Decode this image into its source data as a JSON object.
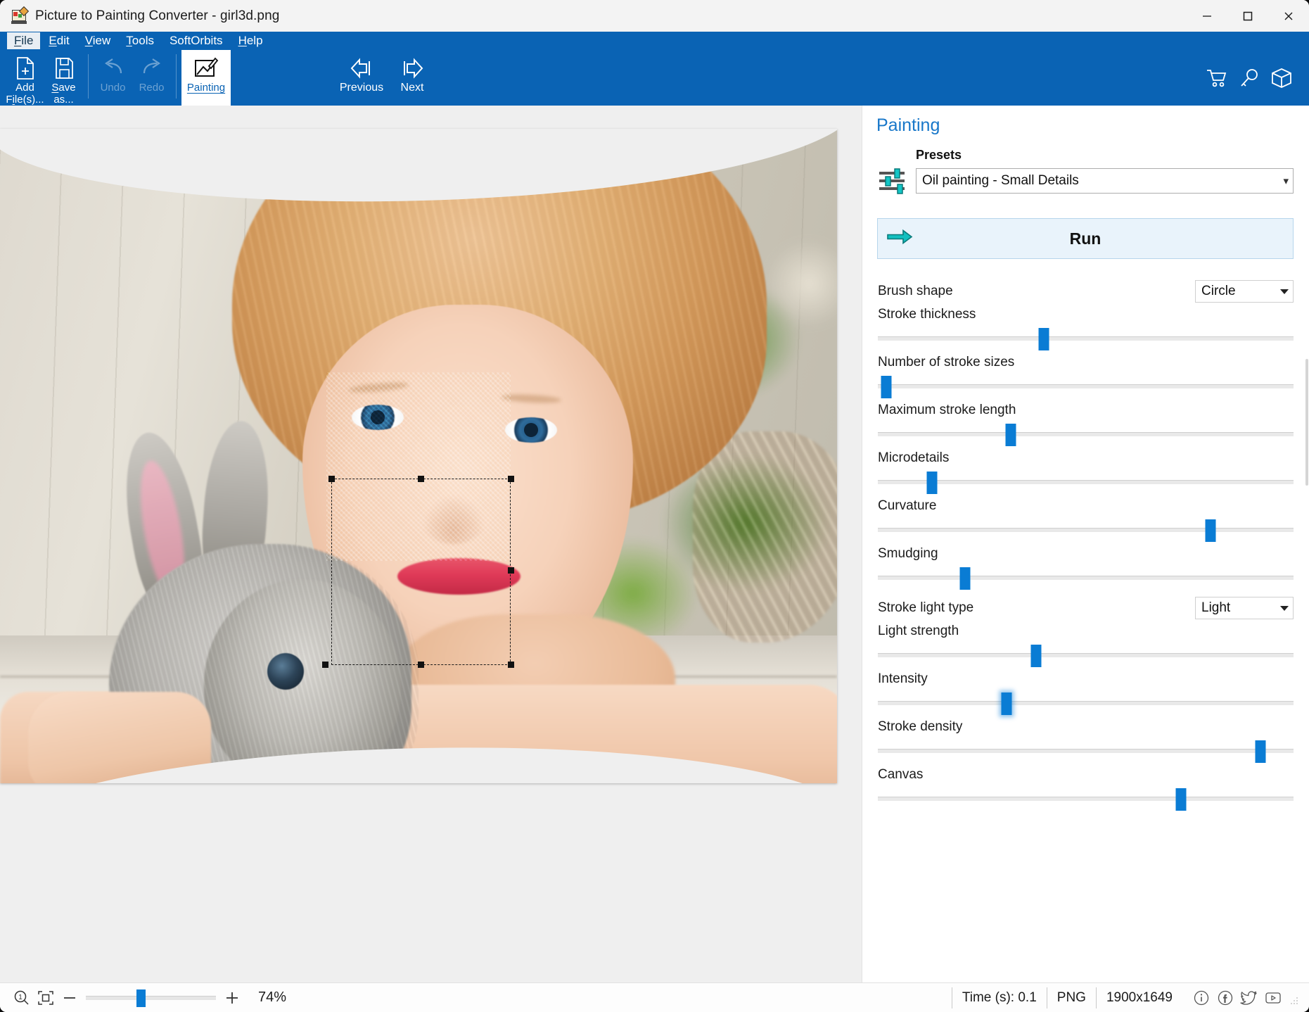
{
  "window": {
    "title": "Picture to Painting Converter - girl3d.png",
    "app_icon": "picture-to-painting-icon",
    "minimize": "minimize-icon",
    "maximize": "maximize-icon",
    "close": "close-icon"
  },
  "menu": {
    "items": [
      {
        "label": "File",
        "accel": "F",
        "active": true
      },
      {
        "label": "Edit",
        "accel": "E",
        "active": false
      },
      {
        "label": "View",
        "accel": "V",
        "active": false
      },
      {
        "label": "Tools",
        "accel": "T",
        "active": false
      },
      {
        "label": "SoftOrbits",
        "accel": "",
        "active": false
      },
      {
        "label": "Help",
        "accel": "H",
        "active": false
      }
    ]
  },
  "toolbar": {
    "add_files": "Add File(s)...",
    "save_as": "Save as...",
    "undo": "Undo",
    "redo": "Redo",
    "painting": "Painting",
    "previous": "Previous",
    "next": "Next",
    "icons": {
      "add": "add-file-icon",
      "save": "save-icon",
      "undo": "undo-arrow-icon",
      "redo": "redo-arrow-icon",
      "painting": "painting-tab-icon",
      "previous": "previous-arrow-icon",
      "next": "next-arrow-icon",
      "cart": "shopping-cart-icon",
      "key": "license-key-icon",
      "box": "product-box-icon"
    }
  },
  "panel": {
    "title": "Painting",
    "presets_label": "Presets",
    "presets_value": "Oil painting - Small Details",
    "presets_icon": "sliders-icon",
    "run_label": "Run",
    "run_icon": "run-arrow-icon",
    "controls": [
      {
        "type": "combo",
        "label": "Brush shape",
        "value": "Circle"
      },
      {
        "type": "slider",
        "label": "Stroke thickness",
        "percent": 40
      },
      {
        "type": "slider",
        "label": "Number of stroke sizes",
        "percent": 2
      },
      {
        "type": "slider",
        "label": "Maximum stroke length",
        "percent": 32
      },
      {
        "type": "slider",
        "label": "Microdetails",
        "percent": 13
      },
      {
        "type": "slider",
        "label": "Curvature",
        "percent": 80
      },
      {
        "type": "slider",
        "label": "Smudging",
        "percent": 21
      },
      {
        "type": "combo",
        "label": "Stroke light type",
        "value": "Light"
      },
      {
        "type": "slider",
        "label": "Light strength",
        "percent": 38
      },
      {
        "type": "slider",
        "label": "Intensity",
        "percent": 31,
        "glow": true
      },
      {
        "type": "slider",
        "label": "Stroke density",
        "percent": 92
      },
      {
        "type": "slider",
        "label": "Canvas",
        "percent": 73
      }
    ]
  },
  "status": {
    "zoom_icon": "zoom-1to1-icon",
    "fit_icon": "fit-to-window-icon",
    "minus": "−",
    "plus": "+",
    "zoom_percent": "74%",
    "time": "Time (s): 0.1",
    "format": "PNG",
    "dimensions": "1900x1649",
    "info_icon": "info-icon",
    "facebook_icon": "facebook-icon",
    "twitter_icon": "twitter-icon",
    "youtube_icon": "youtube-icon"
  },
  "colors": {
    "ribbon_blue": "#0a63b4",
    "accent_blue": "#0a7cd4",
    "panel_title": "#1877c9",
    "run_bg": "#e9f3fb",
    "teal": "#0aa8a8"
  }
}
